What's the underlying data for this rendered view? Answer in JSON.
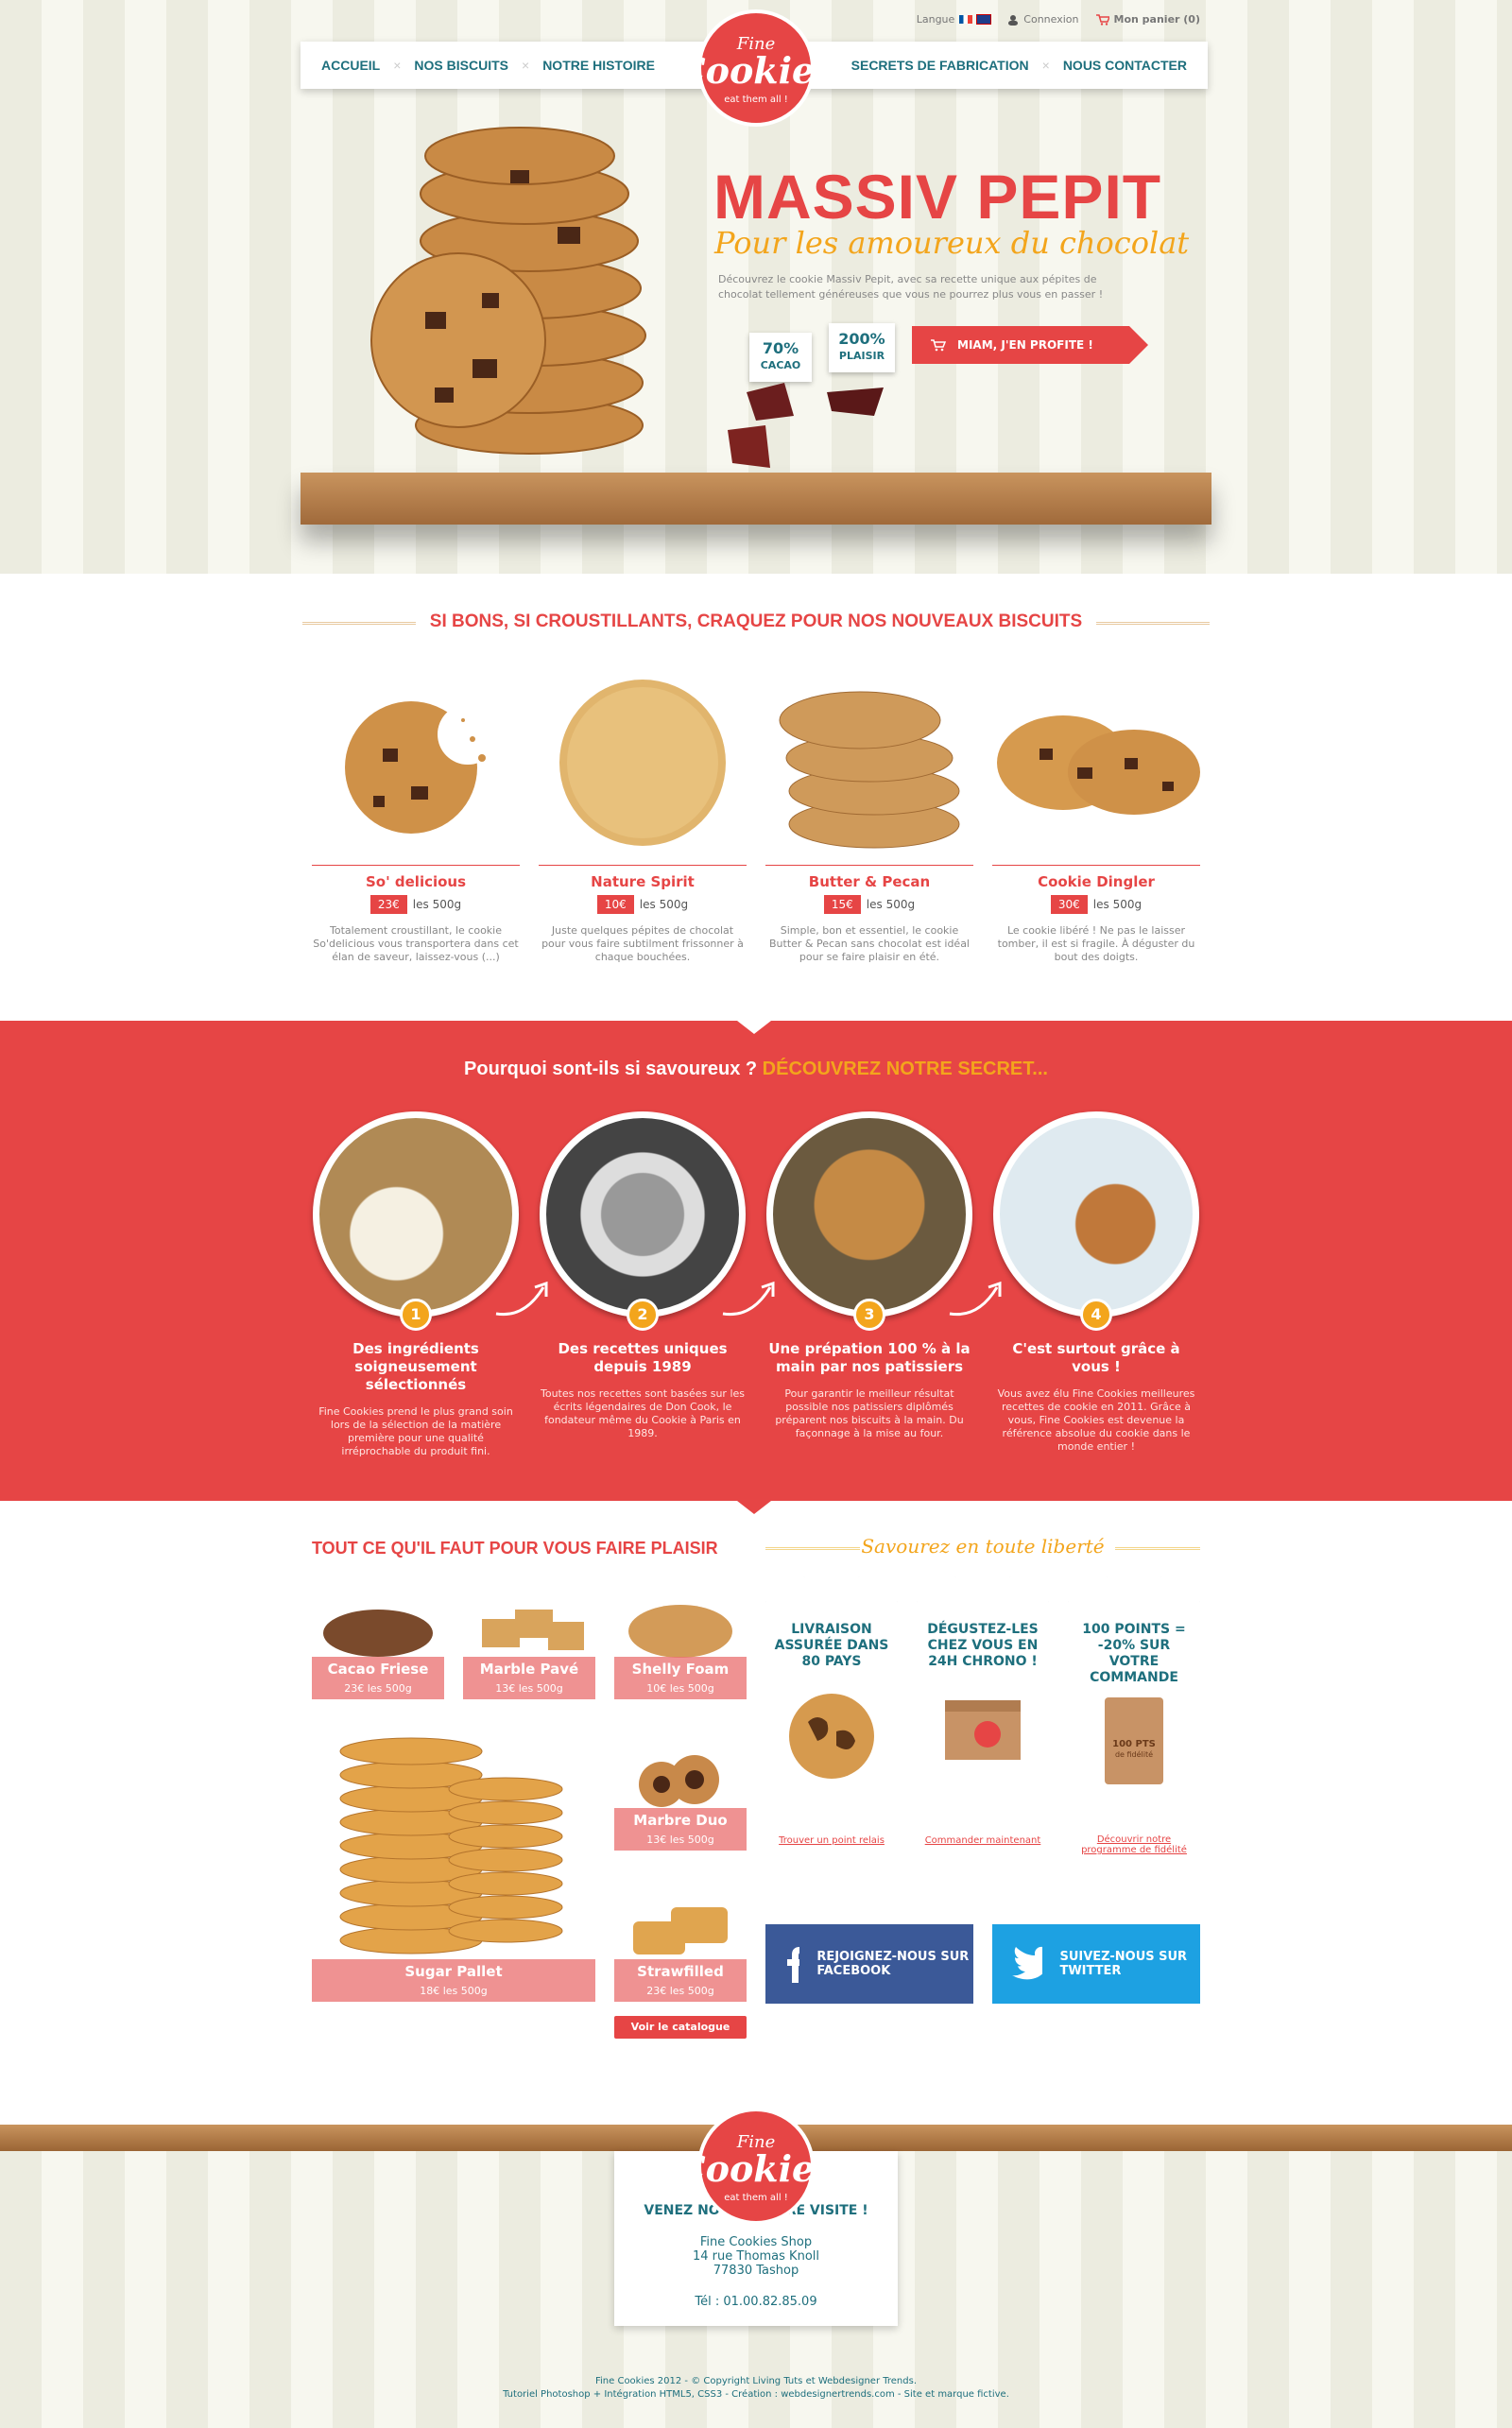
{
  "topbar": {
    "lang": "Langue",
    "login": "Connexion",
    "cart": "Mon panier (0)"
  },
  "nav": {
    "left": [
      "ACCUEIL",
      "NOS BISCUITS",
      "NOTRE HISTOIRE"
    ],
    "right": [
      "SECRETS DE FABRICATION",
      "NOUS CONTACTER"
    ],
    "sep": "×"
  },
  "logo": {
    "top": "Fine",
    "main": "Cookies",
    "tagline": "eat them all !"
  },
  "hero": {
    "title": "MASSIV PEPIT",
    "subtitle": "Pour les amoureux du chocolat",
    "desc": "Découvrez le cookie Massiv Pepit, avec sa recette unique aux pépites de chocolat tellement généreuses que vous ne pourrez plus vous en passer !",
    "cta": "MIAM, J'EN PROFITE !",
    "tag1_val": "70%",
    "tag1_lbl": "CACAO",
    "tag2_val": "200%",
    "tag2_lbl": "PLAISIR"
  },
  "new": {
    "title": "SI BONS, SI CROUSTILLANTS, CRAQUEZ POUR NOS NOUVEAUX BISCUITS",
    "unit": "les 500g",
    "items": [
      {
        "name": "So' delicious",
        "price": "23€",
        "desc": "Totalement croustillant, le cookie So'delicious vous transportera dans cet élan de saveur, laissez-vous (...)"
      },
      {
        "name": "Nature Spirit",
        "price": "10€",
        "desc": "Juste quelques pépites de chocolat pour vous faire subtilment frissonner à chaque bouchées."
      },
      {
        "name": "Butter & Pecan",
        "price": "15€",
        "desc": "Simple, bon et essentiel, le cookie Butter & Pecan sans chocolat est idéal pour se faire plaisir en été."
      },
      {
        "name": "Cookie Dingler",
        "price": "30€",
        "desc": "Le cookie libéré ! Ne pas le laisser tomber, il est si fragile. À déguster du bout des doigts."
      }
    ]
  },
  "secret": {
    "q": "Pourquoi sont-ils si savoureux ?",
    "hl": "DÉCOUVREZ NOTRE SECRET...",
    "steps": [
      {
        "n": "1",
        "h": "Des ingrédients soigneusement sélectionnés",
        "d": "Fine Cookies prend le plus grand soin lors de la sélection de la matière première pour une qualité irréprochable du produit fini."
      },
      {
        "n": "2",
        "h": "Des recettes uniques depuis 1989",
        "d": "Toutes nos recettes sont basées sur les écrits légendaires de Don Cook, le fondateur même du Cookie à Paris en 1989."
      },
      {
        "n": "3",
        "h": "Une prépation 100 % à la main par nos patissiers",
        "d": "Pour garantir le meilleur résultat possible nos patissiers diplômés préparent nos biscuits à la main. Du façonnage à la mise au four."
      },
      {
        "n": "4",
        "h": "C'est surtout grâce à vous !",
        "d": "Vous avez élu Fine Cookies meilleures recettes de cookie en 2011. Grâce à vous, Fine Cookies est devenue la référence absolue du cookie dans le monde entier !"
      }
    ]
  },
  "all": {
    "title": "TOUT CE QU'IL FAUT POUR VOUS FAIRE PLAISIR",
    "script": "Savourez en toute liberté",
    "catalogue": "Voir le catalogue",
    "products": [
      {
        "name": "Cacao Friese",
        "price": "23€ les 500g"
      },
      {
        "name": "Marble Pavé",
        "price": "13€ les 500g"
      },
      {
        "name": "Shelly Foam",
        "price": "10€ les 500g"
      },
      {
        "name": "Marbre Duo",
        "price": "13€ les 500g"
      },
      {
        "name": "Sugar Pallet",
        "price": "18€ les 500g"
      },
      {
        "name": "Strawfilled",
        "price": "23€ les 500g"
      }
    ],
    "services": [
      {
        "h": "LIVRAISON ASSURÉE DANS 80 PAYS",
        "link": "Trouver un point relais"
      },
      {
        "h": "DÉGUSTEZ-LES CHEZ VOUS EN 24H CHRONO !",
        "link": "Commander maintenant"
      },
      {
        "h": "100 POINTS = -20% SUR VOTRE COMMANDE",
        "link": "Découvrir notre programme de fidélité",
        "card": "100 PTS",
        "card_sub": "de fidélité"
      }
    ],
    "facebook": "REJOIGNEZ-NOUS SUR FACEBOOK",
    "twitter": "SUIVEZ-NOUS SUR TWITTER"
  },
  "footer": {
    "h": "VENEZ NOUS RENDRE VISITE !",
    "l1": "Fine Cookies Shop",
    "l2": "14 rue Thomas Knoll",
    "l3": "77830 Tashop",
    "tel": "Tél : 01.00.82.85.09",
    "legal1": "Fine Cookies 2012 -  © Copyright Living Tuts et Webdesigner Trends.",
    "legal2": "Tutoriel Photoshop + Intégration HTML5, CSS3 - Création : webdesignertrends.com - Site et marque fictive."
  },
  "colors": {
    "red": "#e64545",
    "teal": "#1e6f7d",
    "orange": "#f3a51c",
    "facebook": "#3b5998",
    "twitter": "#1da1e2"
  }
}
